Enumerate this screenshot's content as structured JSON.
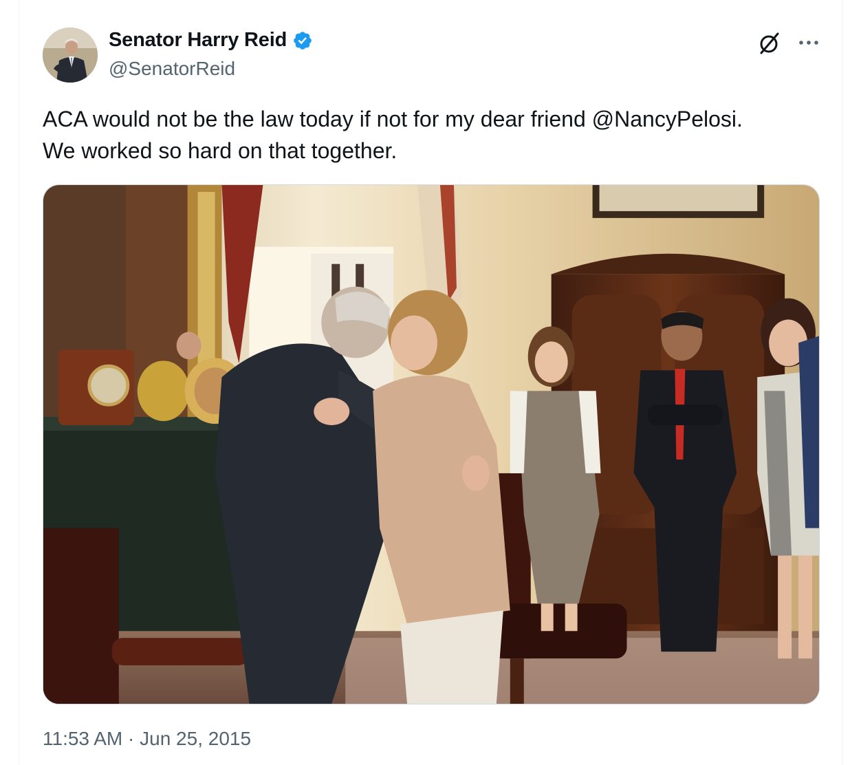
{
  "author": {
    "display_name": "Senator Harry Reid",
    "handle": "@SenatorReid"
  },
  "tweet": {
    "text": "ACA would not be the law today if not for my dear friend @NancyPelosi.\nWe worked so hard on that together."
  },
  "meta": {
    "time": "11:53 AM",
    "separator": " · ",
    "date": "Jun 25, 2015"
  },
  "icons": {
    "verified": "verified-badge-icon",
    "grok": "grok-icon",
    "more": "more-horizontal-icon"
  },
  "colors": {
    "text_primary": "#0f1419",
    "text_secondary": "#536471",
    "verified_blue": "#1d9bf0",
    "border": "#cfd9de"
  }
}
